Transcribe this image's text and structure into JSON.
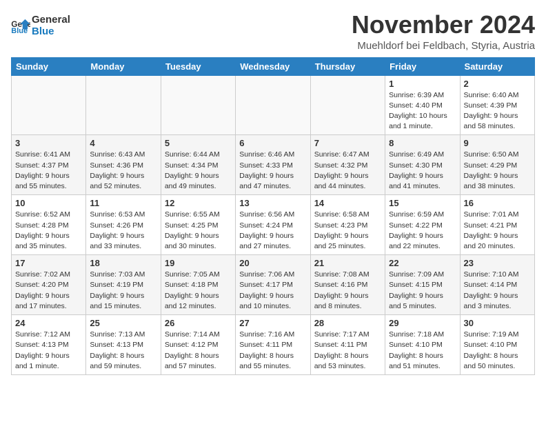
{
  "header": {
    "logo_line1": "General",
    "logo_line2": "Blue",
    "title": "November 2024",
    "subtitle": "Muehldorf bei Feldbach, Styria, Austria"
  },
  "weekdays": [
    "Sunday",
    "Monday",
    "Tuesday",
    "Wednesday",
    "Thursday",
    "Friday",
    "Saturday"
  ],
  "weeks": [
    [
      {
        "day": "",
        "info": ""
      },
      {
        "day": "",
        "info": ""
      },
      {
        "day": "",
        "info": ""
      },
      {
        "day": "",
        "info": ""
      },
      {
        "day": "",
        "info": ""
      },
      {
        "day": "1",
        "info": "Sunrise: 6:39 AM\nSunset: 4:40 PM\nDaylight: 10 hours and 1 minute."
      },
      {
        "day": "2",
        "info": "Sunrise: 6:40 AM\nSunset: 4:39 PM\nDaylight: 9 hours and 58 minutes."
      }
    ],
    [
      {
        "day": "3",
        "info": "Sunrise: 6:41 AM\nSunset: 4:37 PM\nDaylight: 9 hours and 55 minutes."
      },
      {
        "day": "4",
        "info": "Sunrise: 6:43 AM\nSunset: 4:36 PM\nDaylight: 9 hours and 52 minutes."
      },
      {
        "day": "5",
        "info": "Sunrise: 6:44 AM\nSunset: 4:34 PM\nDaylight: 9 hours and 49 minutes."
      },
      {
        "day": "6",
        "info": "Sunrise: 6:46 AM\nSunset: 4:33 PM\nDaylight: 9 hours and 47 minutes."
      },
      {
        "day": "7",
        "info": "Sunrise: 6:47 AM\nSunset: 4:32 PM\nDaylight: 9 hours and 44 minutes."
      },
      {
        "day": "8",
        "info": "Sunrise: 6:49 AM\nSunset: 4:30 PM\nDaylight: 9 hours and 41 minutes."
      },
      {
        "day": "9",
        "info": "Sunrise: 6:50 AM\nSunset: 4:29 PM\nDaylight: 9 hours and 38 minutes."
      }
    ],
    [
      {
        "day": "10",
        "info": "Sunrise: 6:52 AM\nSunset: 4:28 PM\nDaylight: 9 hours and 35 minutes."
      },
      {
        "day": "11",
        "info": "Sunrise: 6:53 AM\nSunset: 4:26 PM\nDaylight: 9 hours and 33 minutes."
      },
      {
        "day": "12",
        "info": "Sunrise: 6:55 AM\nSunset: 4:25 PM\nDaylight: 9 hours and 30 minutes."
      },
      {
        "day": "13",
        "info": "Sunrise: 6:56 AM\nSunset: 4:24 PM\nDaylight: 9 hours and 27 minutes."
      },
      {
        "day": "14",
        "info": "Sunrise: 6:58 AM\nSunset: 4:23 PM\nDaylight: 9 hours and 25 minutes."
      },
      {
        "day": "15",
        "info": "Sunrise: 6:59 AM\nSunset: 4:22 PM\nDaylight: 9 hours and 22 minutes."
      },
      {
        "day": "16",
        "info": "Sunrise: 7:01 AM\nSunset: 4:21 PM\nDaylight: 9 hours and 20 minutes."
      }
    ],
    [
      {
        "day": "17",
        "info": "Sunrise: 7:02 AM\nSunset: 4:20 PM\nDaylight: 9 hours and 17 minutes."
      },
      {
        "day": "18",
        "info": "Sunrise: 7:03 AM\nSunset: 4:19 PM\nDaylight: 9 hours and 15 minutes."
      },
      {
        "day": "19",
        "info": "Sunrise: 7:05 AM\nSunset: 4:18 PM\nDaylight: 9 hours and 12 minutes."
      },
      {
        "day": "20",
        "info": "Sunrise: 7:06 AM\nSunset: 4:17 PM\nDaylight: 9 hours and 10 minutes."
      },
      {
        "day": "21",
        "info": "Sunrise: 7:08 AM\nSunset: 4:16 PM\nDaylight: 9 hours and 8 minutes."
      },
      {
        "day": "22",
        "info": "Sunrise: 7:09 AM\nSunset: 4:15 PM\nDaylight: 9 hours and 5 minutes."
      },
      {
        "day": "23",
        "info": "Sunrise: 7:10 AM\nSunset: 4:14 PM\nDaylight: 9 hours and 3 minutes."
      }
    ],
    [
      {
        "day": "24",
        "info": "Sunrise: 7:12 AM\nSunset: 4:13 PM\nDaylight: 9 hours and 1 minute."
      },
      {
        "day": "25",
        "info": "Sunrise: 7:13 AM\nSunset: 4:13 PM\nDaylight: 8 hours and 59 minutes."
      },
      {
        "day": "26",
        "info": "Sunrise: 7:14 AM\nSunset: 4:12 PM\nDaylight: 8 hours and 57 minutes."
      },
      {
        "day": "27",
        "info": "Sunrise: 7:16 AM\nSunset: 4:11 PM\nDaylight: 8 hours and 55 minutes."
      },
      {
        "day": "28",
        "info": "Sunrise: 7:17 AM\nSunset: 4:11 PM\nDaylight: 8 hours and 53 minutes."
      },
      {
        "day": "29",
        "info": "Sunrise: 7:18 AM\nSunset: 4:10 PM\nDaylight: 8 hours and 51 minutes."
      },
      {
        "day": "30",
        "info": "Sunrise: 7:19 AM\nSunset: 4:10 PM\nDaylight: 8 hours and 50 minutes."
      }
    ]
  ]
}
